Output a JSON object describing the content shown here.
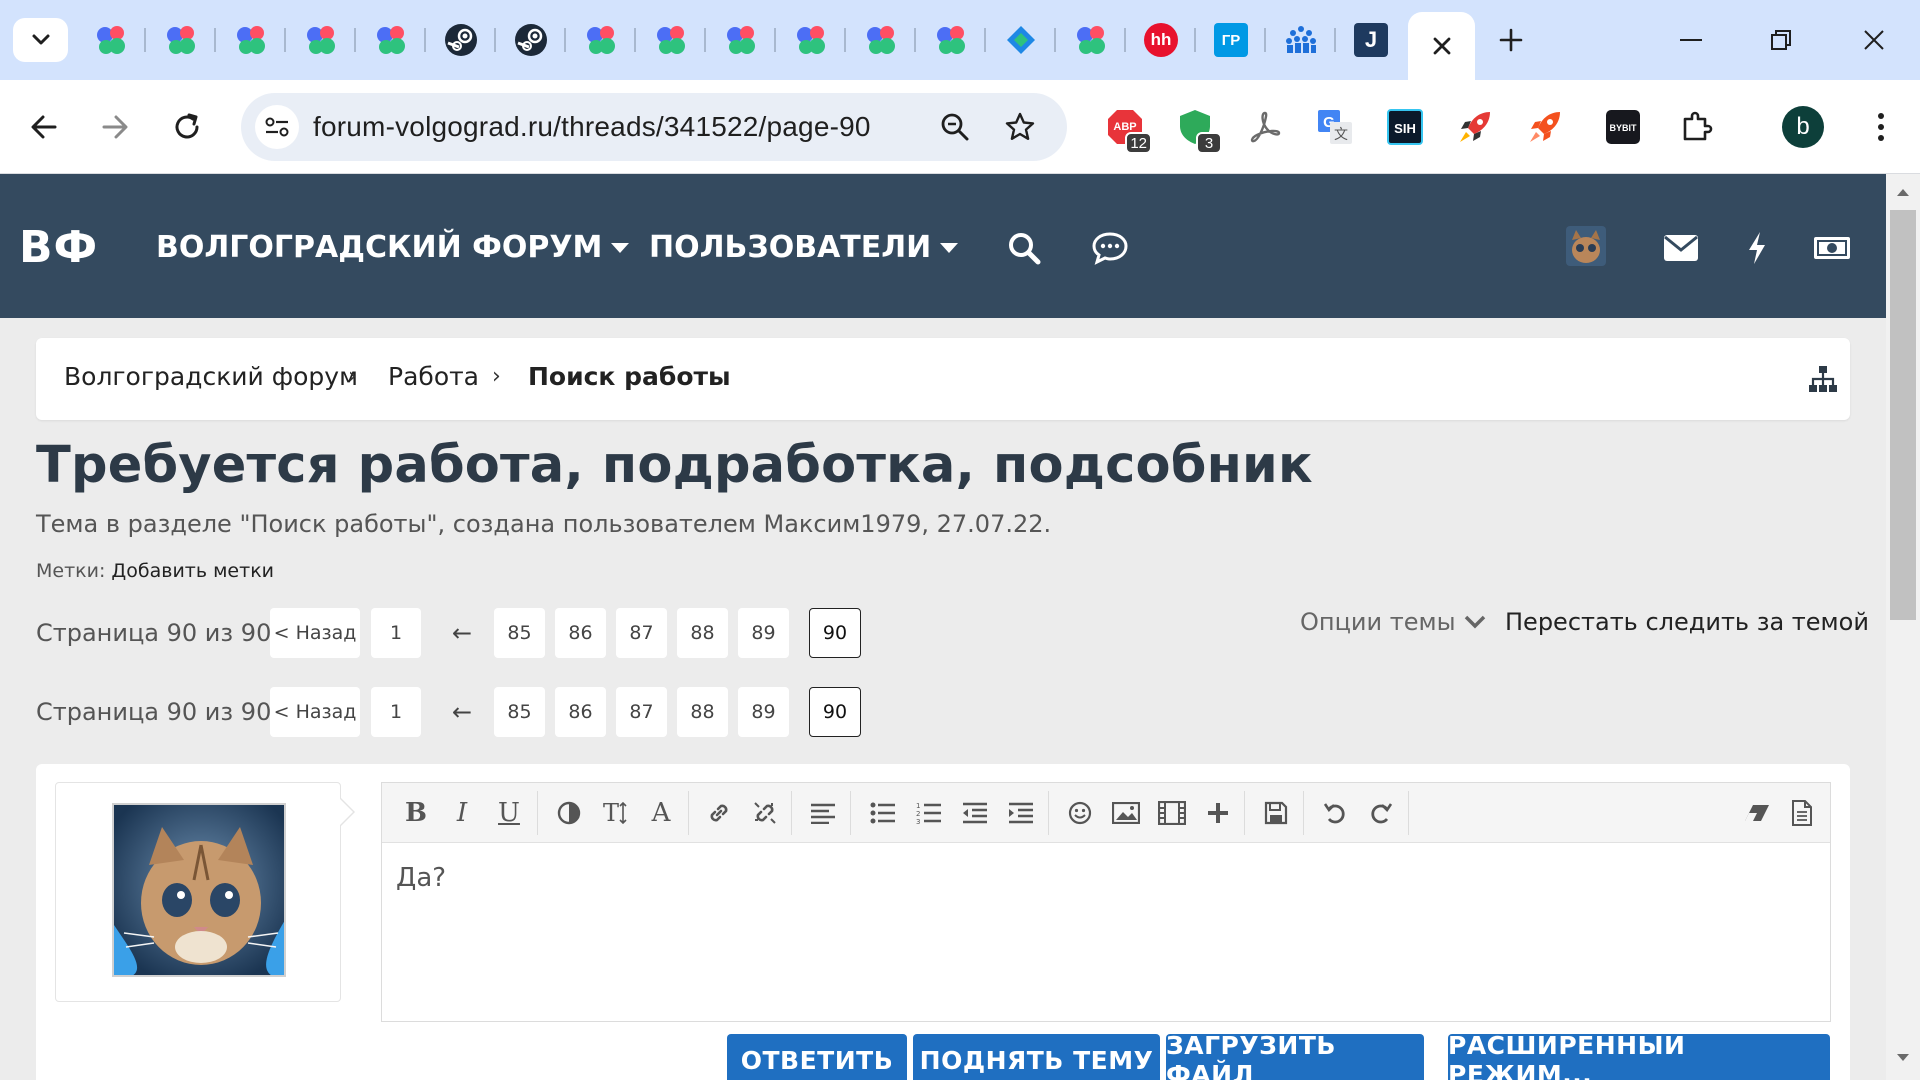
{
  "browser": {
    "url": "forum-volgograd.ru/threads/341522/page-90",
    "extension_badges": {
      "adblock": "12",
      "shield": "3"
    },
    "profile_initial": "b",
    "tab_labels": {
      "hh": "hh",
      "gr": "ГР",
      "j": "J"
    }
  },
  "site": {
    "logo": "ВФ",
    "nav": {
      "forum": "ВОЛГОГРАДСКИЙ ФОРУМ",
      "users": "ПОЛЬЗОВАТЕЛИ"
    },
    "header_color": "#344a5f"
  },
  "breadcrumb": [
    "Волгоградский форум",
    "Работа",
    "Поиск работы"
  ],
  "thread": {
    "title": "Требуется работа, подработка, подсобник",
    "meta": "Тема в разделе \"Поиск работы\", создана пользователем Максим1979, 27.07.22.",
    "tags_label": "Метки: ",
    "tags_add": "Добавить метки",
    "options": "Опции темы",
    "unwatch": "Перестать следить за темой"
  },
  "pager": {
    "label": "Страница 90 из 90",
    "prev": "< Назад",
    "first": "1",
    "gap": "←",
    "pages": [
      "85",
      "86",
      "87",
      "88",
      "89",
      "90"
    ],
    "current": "90"
  },
  "editor": {
    "toolbar_letters": {
      "bold": "B",
      "italic": "I",
      "underline": "U",
      "textsize": "T",
      "font": "A"
    },
    "content": "Да?"
  },
  "actions": {
    "reply": "ОТВЕТИТЬ",
    "bump": "ПОДНЯТЬ ТЕМУ",
    "upload": "ЗАГРУЗИТЬ ФАЙЛ",
    "advanced": "РАСШИРЕННЫЙ РЕЖИМ..."
  },
  "colors": {
    "accent_button": "#1f6fc1",
    "tabstrip": "#d3e3fd",
    "omnibox": "#e9eef6"
  }
}
